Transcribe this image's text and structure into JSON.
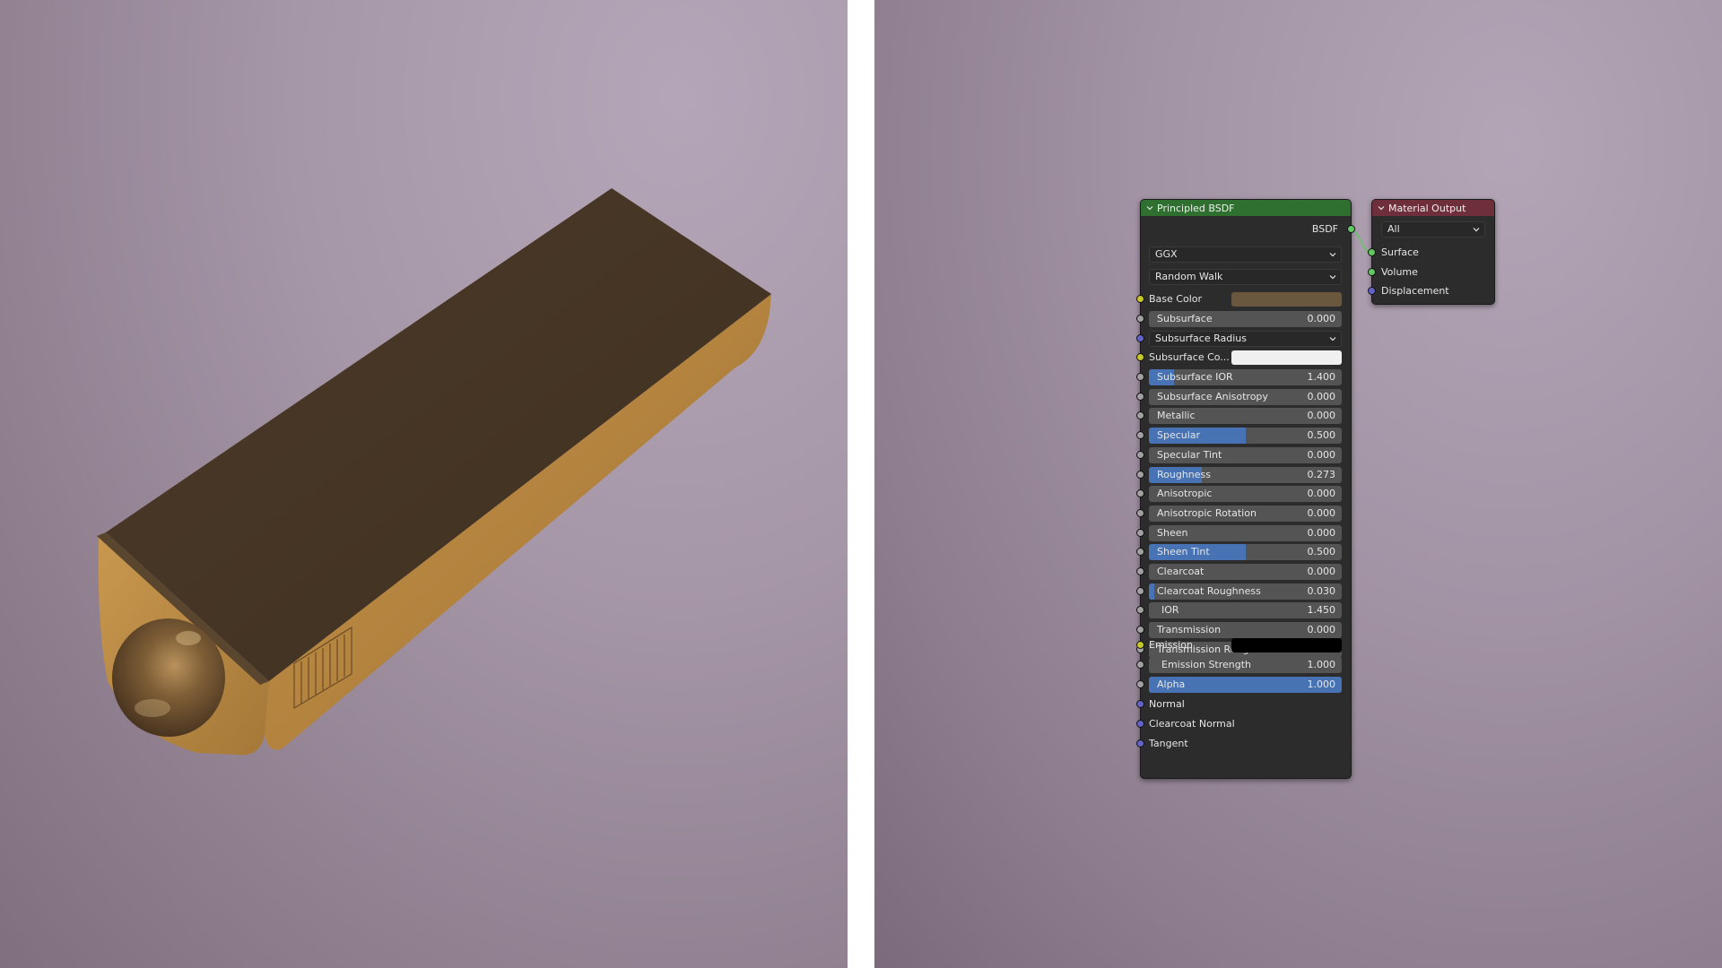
{
  "colors": {
    "bsdf_header": "#2f6f2f",
    "output_header": "#6e2f3a",
    "slider_fill": "#4772b3",
    "base_color_swatch": "#6b573d",
    "subsurface_color_swatch": "#f0f0f0",
    "emission_swatch": "#000000"
  },
  "bsdf_node": {
    "title": "Principled BSDF",
    "output_label": "BSDF",
    "distribution": "GGX",
    "subsurface_method": "Random Walk",
    "base_color_label": "Base Color",
    "subsurface_radius_label": "Subsurface Radius",
    "subsurface_color_label": "Subsurface Co...",
    "emission_label": "Emission",
    "normal_label": "Normal",
    "clearcoat_normal_label": "Clearcoat Normal",
    "tangent_label": "Tangent",
    "sliders": [
      {
        "label": "Subsurface",
        "value": "0.000",
        "fraction": 0.0
      },
      {
        "label": "Subsurface IOR",
        "value": "1.400",
        "fraction": 0.13
      },
      {
        "label": "Subsurface Anisotropy",
        "value": "0.000",
        "fraction": 0.0
      },
      {
        "label": "Metallic",
        "value": "0.000",
        "fraction": 0.0
      },
      {
        "label": "Specular",
        "value": "0.500",
        "fraction": 0.5
      },
      {
        "label": "Specular Tint",
        "value": "0.000",
        "fraction": 0.0
      },
      {
        "label": "Roughness",
        "value": "0.273",
        "fraction": 0.273
      },
      {
        "label": "Anisotropic",
        "value": "0.000",
        "fraction": 0.0
      },
      {
        "label": "Anisotropic Rotation",
        "value": "0.000",
        "fraction": 0.0
      },
      {
        "label": "Sheen",
        "value": "0.000",
        "fraction": 0.0
      },
      {
        "label": "Sheen Tint",
        "value": "0.500",
        "fraction": 0.5
      },
      {
        "label": "Clearcoat",
        "value": "0.000",
        "fraction": 0.0
      },
      {
        "label": "Clearcoat Roughness",
        "value": "0.030",
        "fraction": 0.03
      },
      {
        "label": "IOR",
        "value": "1.450",
        "fraction": 0.0
      },
      {
        "label": "Transmission",
        "value": "0.000",
        "fraction": 0.0
      },
      {
        "label": "Transmission Roughness",
        "value": "0.000",
        "fraction": 0.0
      }
    ],
    "emission_strength": {
      "label": "Emission Strength",
      "value": "1.000",
      "fraction": 0.0
    },
    "alpha": {
      "label": "Alpha",
      "value": "1.000",
      "fraction": 1.0
    }
  },
  "output_node": {
    "title": "Material Output",
    "target": "All",
    "inputs": [
      "Surface",
      "Volume",
      "Displacement"
    ]
  }
}
